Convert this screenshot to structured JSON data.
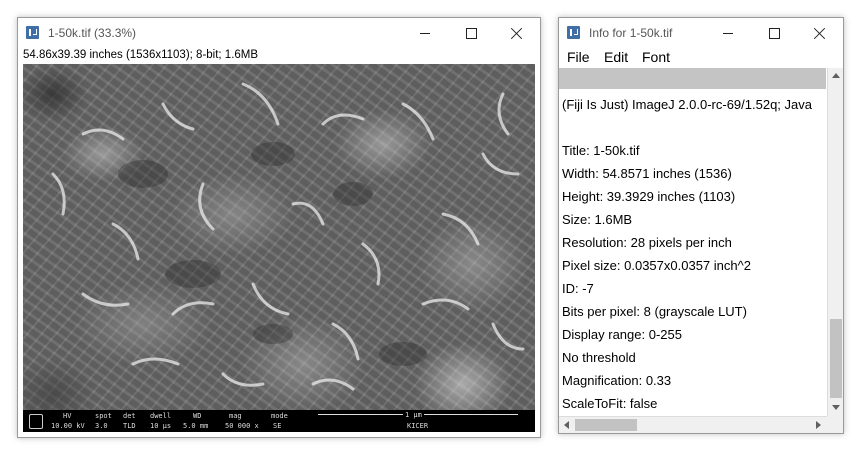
{
  "image_window": {
    "title": "1-50k.tif (33.3%)",
    "info_line": "54.86x39.39 inches (1536x1103); 8-bit; 1.6MB",
    "image_alt": "SEM micrograph",
    "databar": {
      "headers": [
        "HV",
        "spot",
        "det",
        "dwell",
        "WD",
        "mag",
        "mode"
      ],
      "values": [
        "10.00 kV",
        "3.0",
        "TLD",
        "10 µs",
        "5.0 mm",
        "50 000 x",
        "SE"
      ],
      "scale_label": "1 µm",
      "org": "KICER"
    }
  },
  "info_window": {
    "title": "Info for 1-50k.tif",
    "menu": [
      "File",
      "Edit",
      "Font"
    ],
    "lines": [
      "(Fiji Is Just) ImageJ 2.0.0-rc-69/1.52q; Java",
      "",
      "Title: 1-50k.tif",
      "Width:  54.8571 inches (1536)",
      "Height:  39.3929 inches (1103)",
      "Size:  1.6MB",
      "Resolution:  28 pixels per inch",
      "Pixel size: 0.0357x0.0357 inch^2",
      "ID: -7",
      "Bits per pixel: 8 (grayscale LUT)",
      "Display range: 0-255",
      "No threshold",
      "Magnification: 0.33",
      "ScaleToFit: false"
    ]
  }
}
